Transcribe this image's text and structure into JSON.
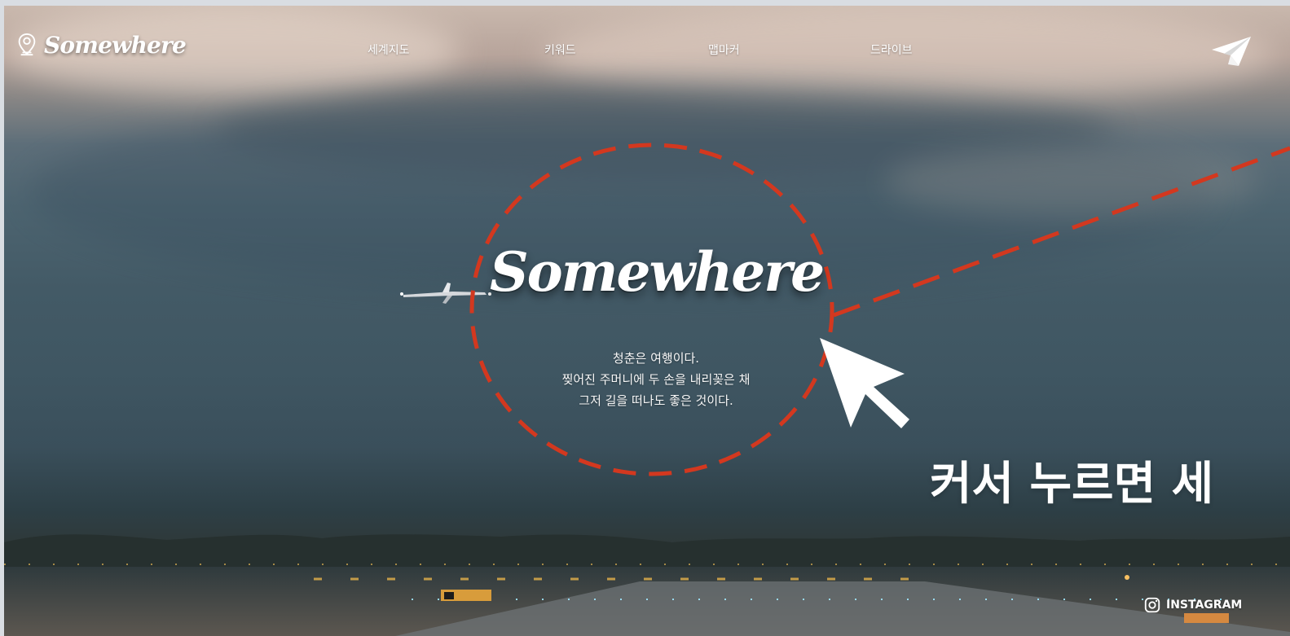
{
  "app": {
    "brand": "Somewhere"
  },
  "nav": {
    "items": [
      {
        "label": "세계지도"
      },
      {
        "label": "키워드"
      },
      {
        "label": "맵마커"
      },
      {
        "label": "드라이브"
      }
    ]
  },
  "hero": {
    "title": "Somewhere",
    "quote_lines": [
      "청춘은 여행이다.",
      "찢어진 주머니에 두 손을 내리꽂은 채",
      "그저 길을 떠나도 좋은 것이다."
    ]
  },
  "annotation": {
    "text": "커서 누르면 세"
  },
  "footer": {
    "instagram_label": "INSTAGRAM"
  },
  "icons": {
    "brand": "map-pin-person-icon",
    "send": "paper-plane-icon",
    "cursor": "cursor-arrow-icon",
    "instagram": "instagram-icon",
    "airplane": "airplane-icon"
  },
  "colors": {
    "annotation": "#d3381f",
    "text": "#ffffff"
  }
}
